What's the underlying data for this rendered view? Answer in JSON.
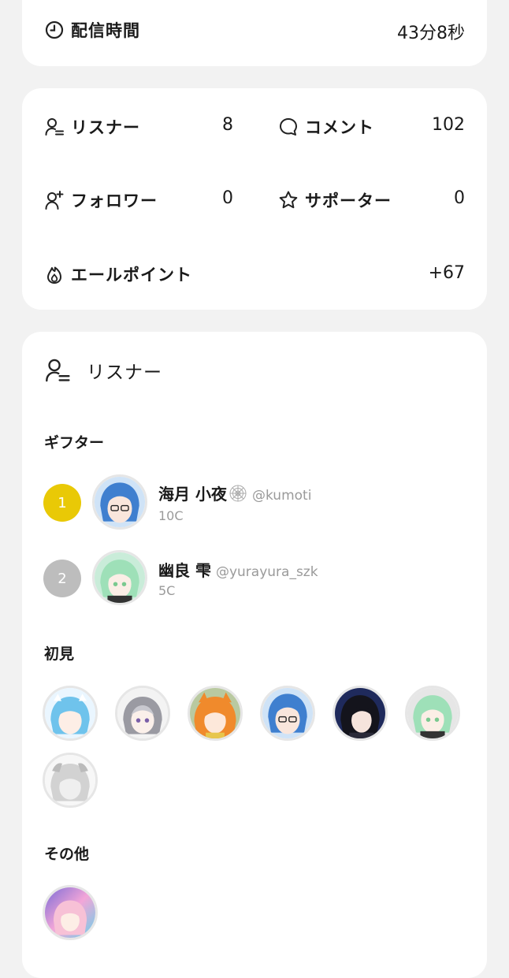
{
  "duration": {
    "label": "配信時間",
    "value": "43分8秒",
    "icon": "clock-icon"
  },
  "stats": {
    "listeners": {
      "label": "リスナー",
      "value": "8",
      "icon": "person-list-icon"
    },
    "comments": {
      "label": "コメント",
      "value": "102",
      "icon": "speech-bubble-icon"
    },
    "followers": {
      "label": "フォロワー",
      "value": "0",
      "icon": "person-plus-icon"
    },
    "supporters": {
      "label": "サポーター",
      "value": "0",
      "icon": "star-icon"
    },
    "cheer_points": {
      "label": "エールポイント",
      "value": "+67",
      "icon": "flame-icon"
    }
  },
  "listeners_panel": {
    "title": "リスナー",
    "gifters_heading": "ギフター",
    "gifters": [
      {
        "rank": "1",
        "name": "海月 小夜",
        "handle": "@kumoti",
        "coins": "10C",
        "rank_color": "#e9c906"
      },
      {
        "rank": "2",
        "name": "幽良 雫",
        "handle": "@yurayura_szk",
        "coins": "5C",
        "rank_color": "#bdbdbd"
      }
    ],
    "first_time_heading": "初見",
    "others_heading": "その他"
  }
}
